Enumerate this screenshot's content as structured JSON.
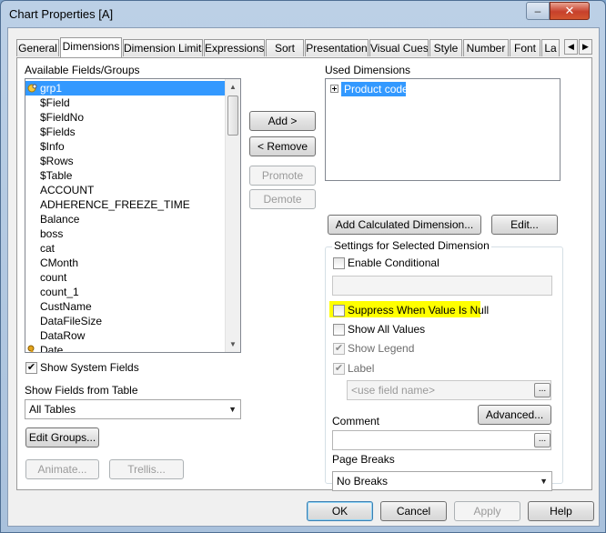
{
  "window": {
    "title": "Chart Properties [A]",
    "minimize_glyph": "‒",
    "close_glyph": "✕"
  },
  "tabs": [
    "General",
    "Dimensions",
    "Dimension Limits",
    "Expressions",
    "Sort",
    "Presentation",
    "Visual Cues",
    "Style",
    "Number",
    "Font",
    "La"
  ],
  "tab_scroll": {
    "left": "◀",
    "right": "▶"
  },
  "left": {
    "available_label": "Available Fields/Groups",
    "fields": [
      "grp1",
      "$Field",
      "$FieldNo",
      "$Fields",
      "$Info",
      "$Rows",
      "$Table",
      "ACCOUNT",
      "ADHERENCE_FREEZE_TIME",
      "Balance",
      "boss",
      "cat",
      "CMonth",
      "count",
      "count_1",
      "CustName",
      "DataFileSize",
      "DataRow",
      "Date"
    ],
    "show_system_fields": "Show System Fields",
    "show_fields_from_table": "Show Fields from Table",
    "table_select": "All Tables",
    "edit_groups": "Edit Groups...",
    "animate": "Animate...",
    "trellis": "Trellis..."
  },
  "middle": {
    "add": "Add >",
    "remove": "< Remove",
    "promote": "Promote",
    "demote": "Demote"
  },
  "right": {
    "used_label": "Used Dimensions",
    "used_items": [
      "Product code"
    ],
    "add_calculated": "Add Calculated Dimension...",
    "edit": "Edit...",
    "settings_title": "Settings for Selected Dimension",
    "enable_conditional": "Enable Conditional",
    "suppress_null": "Suppress When Value Is Null",
    "show_all_values": "Show All Values",
    "show_legend": "Show Legend",
    "label": "Label",
    "label_placeholder": "<use field name>",
    "advanced": "Advanced...",
    "comment": "Comment",
    "page_breaks": "Page Breaks",
    "page_breaks_value": "No Breaks"
  },
  "footer": {
    "ok": "OK",
    "cancel": "Cancel",
    "apply": "Apply",
    "help": "Help"
  },
  "colors": {
    "selection": "#3399ff",
    "highlight": "#ffff00"
  }
}
